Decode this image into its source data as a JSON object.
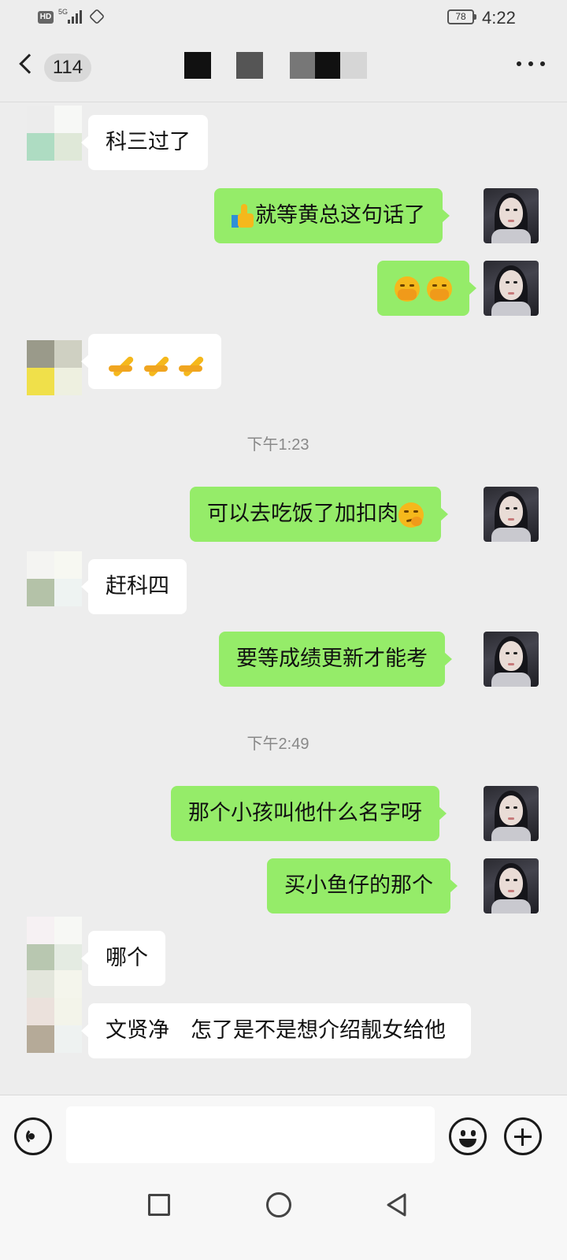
{
  "status_bar": {
    "hd": "HD",
    "network": "5G",
    "battery": "78",
    "time": "4:22"
  },
  "nav": {
    "unread_count": "114"
  },
  "messages": [
    {
      "side": "in",
      "text": "科三过了"
    },
    {
      "side": "out",
      "emoji_before": "thumbs-up",
      "text": "就等黄总这句话了"
    },
    {
      "side": "out",
      "emoji_only": [
        "hugging-face",
        "hugging-face"
      ]
    },
    {
      "side": "in",
      "emoji_only": [
        "folded-hands",
        "folded-hands",
        "folded-hands"
      ]
    },
    {
      "side": "out",
      "text": "可以去吃饭了加扣肉",
      "emoji_after": "smirk-face"
    },
    {
      "side": "in",
      "text": "赶科四"
    },
    {
      "side": "out",
      "text": "要等成绩更新才能考"
    },
    {
      "side": "out",
      "text": "那个小孩叫他什么名字呀"
    },
    {
      "side": "out",
      "text": "买小鱼仔的那个"
    },
    {
      "side": "in",
      "text": "哪个"
    },
    {
      "side": "in",
      "text": "文贤净　怎了是不是想介绍靓女给他"
    }
  ],
  "timestamps": [
    "下午1:23",
    "下午2:49"
  ],
  "colors": {
    "background": "#ededed",
    "bubble_out": "#95ec69",
    "bubble_in": "#ffffff"
  },
  "input": {
    "placeholder": ""
  }
}
